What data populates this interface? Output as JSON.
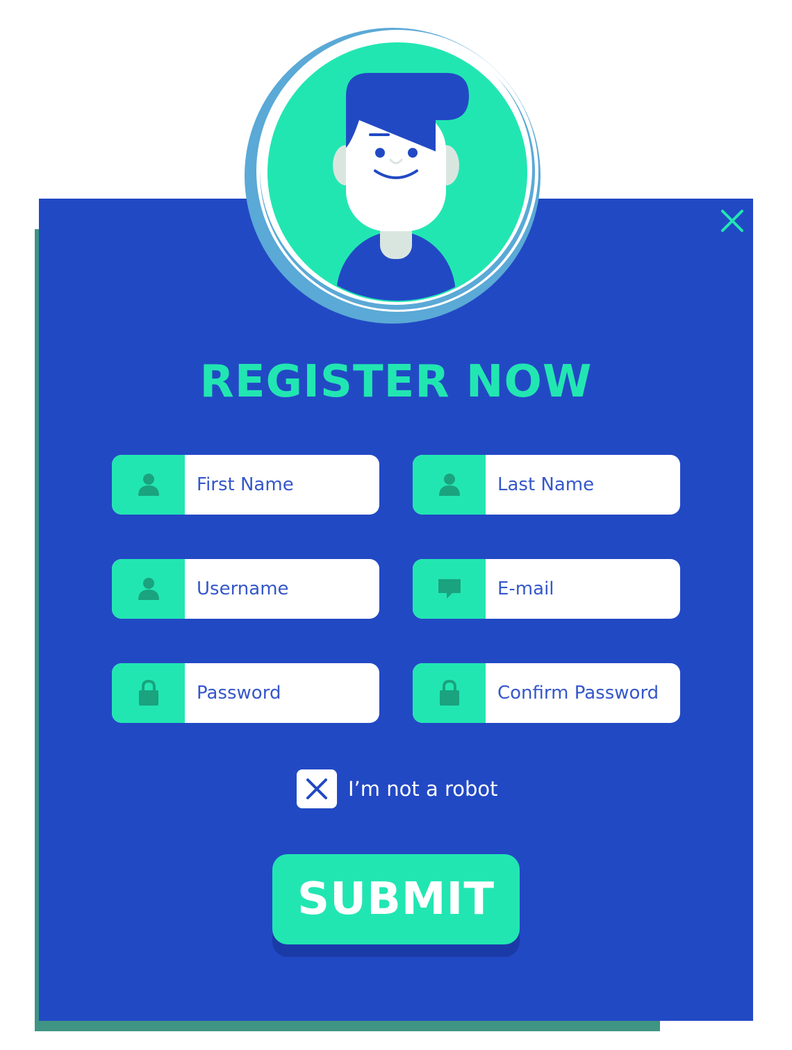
{
  "form": {
    "title": "REGISTER NOW",
    "fields": [
      {
        "placeholder": "First Name",
        "icon": "user-icon"
      },
      {
        "placeholder": "Last Name",
        "icon": "user-icon"
      },
      {
        "placeholder": "Username",
        "icon": "user-icon"
      },
      {
        "placeholder": "E-mail",
        "icon": "message-icon"
      },
      {
        "placeholder": "Password",
        "icon": "lock-icon"
      },
      {
        "placeholder": "Confirm Password",
        "icon": "lock-icon"
      }
    ],
    "captcha_label": "I’m not a robot",
    "submit_label": "SUBMIT"
  },
  "colors": {
    "panel": "#2249c4",
    "accent": "#22e6b2",
    "field_text": "#3557c9",
    "shadow": "#3f9483"
  },
  "icons": {
    "close": "close-icon",
    "avatar": "avatar-illustration",
    "captcha": "x-mark-icon"
  }
}
